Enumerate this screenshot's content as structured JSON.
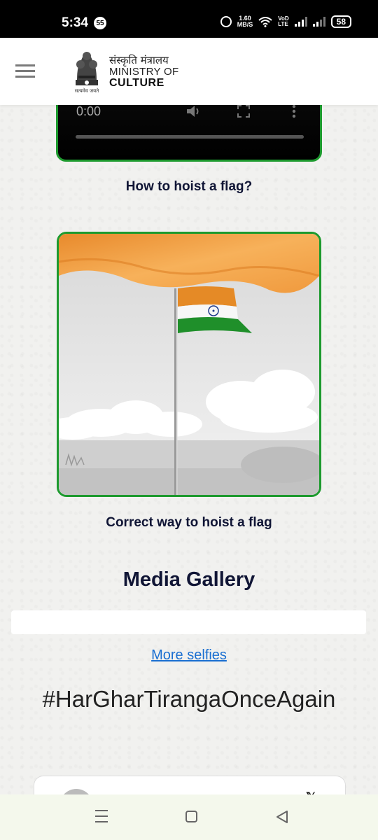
{
  "status_bar": {
    "time": "5:34",
    "notification_count": "55",
    "speed_value": "1.60",
    "speed_unit": "MB/S",
    "volte_top": "VoD",
    "volte_bottom": "LTE",
    "battery": "58"
  },
  "header": {
    "brand_hindi": "संस्कृति मंत्रालय",
    "brand_line2": "MINISTRY OF",
    "brand_line3": "CULTURE",
    "emblem_motto": "सत्यमेव जयते"
  },
  "video": {
    "time": "0:00",
    "caption": "How to hoist a flag?"
  },
  "flag_animation": {
    "caption": "Correct way to hoist a flag"
  },
  "media_gallery": {
    "title": "Media Gallery",
    "more_link": "More selfies"
  },
  "hashtag": "#HarGharTirangaOnceAgain",
  "colors": {
    "accent_green": "#1d9a2e",
    "heading_navy": "#101535",
    "link_blue": "#1a6fd1",
    "saffron": "#f4a340",
    "india_green": "#1f8f2a"
  }
}
